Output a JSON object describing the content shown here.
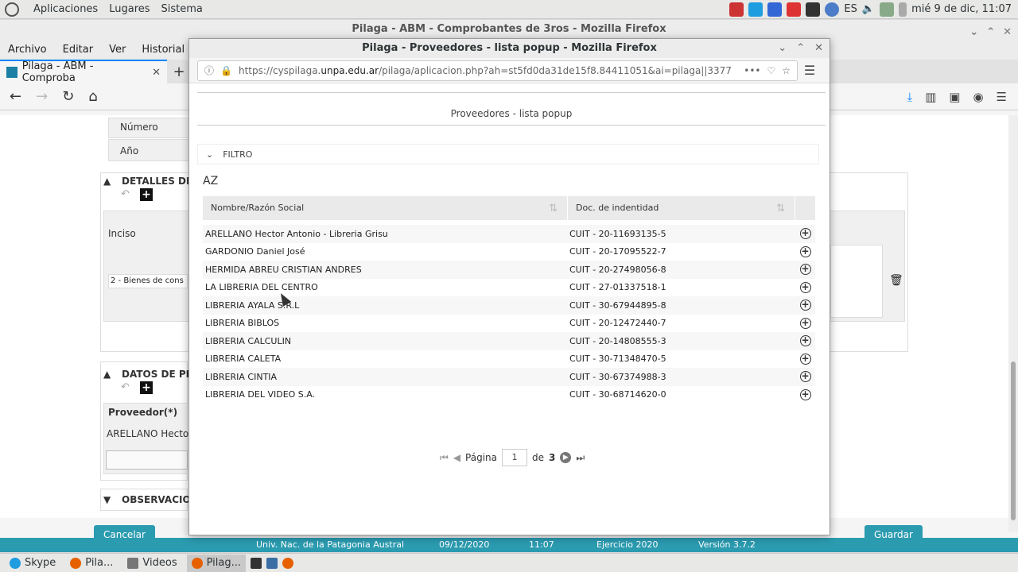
{
  "top_panel": {
    "menu": [
      "Aplicaciones",
      "Lugares",
      "Sistema"
    ],
    "lang": "ES",
    "clock": "mié  9 de dic, 11:07"
  },
  "main_window": {
    "title": "Pilaga - ABM - Comprobantes de 3ros - Mozilla Firefox",
    "menubar": [
      "Archivo",
      "Editar",
      "Ver",
      "Historial"
    ],
    "tab_label": "Pilaga - ABM - Comproba",
    "form": {
      "numero_label": "Número",
      "anio_label": "Año",
      "detalles_title": "DETALLES DEL",
      "inciso_label": "Inciso",
      "inciso_value": "2 - Bienes de cons",
      "datos_title": "DATOS DE PRE",
      "proveedor_label": "Proveedor(*)",
      "proveedor_value": "ARELLANO Hector",
      "observaciones_title": "OBSERVACIO",
      "cancel_label": "Cancelar",
      "save_label": "Guardar"
    },
    "status": {
      "org": "Univ. Nac. de la Patagonia Austral",
      "date": "09/12/2020",
      "time": "11:07",
      "ejercicio": "Ejercicio 2020",
      "version": "Versión 3.7.2"
    }
  },
  "popup": {
    "title": "Pilaga - Proveedores - lista popup - Mozilla Firefox",
    "url_prefix": "https://cyspilaga.",
    "url_domain": "unpa.edu.ar",
    "url_rest": "/pilaga/aplicacion.php?ah=st5fd0da31de15f8.84411051&ai=pilaga||3377",
    "header": "Proveedores - lista popup",
    "filtro_label": "FILTRO",
    "az_label": "AZ",
    "columns": [
      "Nombre/Razón Social",
      "Doc. de indentidad"
    ],
    "rows": [
      {
        "name": "ARELLANO Hector Antonio - Libreria Grisu",
        "doc": "CUIT - 20-11693135-5"
      },
      {
        "name": "GARDONIO Daniel José",
        "doc": "CUIT - 20-17095522-7"
      },
      {
        "name": "HERMIDA ABREU CRISTIAN ANDRES",
        "doc": "CUIT - 20-27498056-8"
      },
      {
        "name": "LA LIBRERIA DEL CENTRO",
        "doc": "CUIT - 27-01337518-1"
      },
      {
        "name": "LIBRERIA AYALA S.R.L",
        "doc": "CUIT - 30-67944895-8"
      },
      {
        "name": "LIBRERIA BIBLOS",
        "doc": "CUIT - 20-12472440-7"
      },
      {
        "name": "LIBRERIA CALCULIN",
        "doc": "CUIT - 20-14808555-3"
      },
      {
        "name": "LIBRERIA CALETA",
        "doc": "CUIT - 30-71348470-5"
      },
      {
        "name": "LIBRERIA CINTIA",
        "doc": "CUIT - 30-67374988-3"
      },
      {
        "name": "LIBRERIA DEL VIDEO S.A.",
        "doc": "CUIT - 30-68714620-0"
      }
    ],
    "pager": {
      "pagina_label": "Página",
      "current_page": "1",
      "of_label": "de",
      "total_pages": "3"
    }
  },
  "taskbar": {
    "items": [
      "Skype",
      "Pila...",
      "Videos",
      "Pilag..."
    ]
  },
  "colors": {
    "accent_teal": "#2b9bb0",
    "firefox_blue": "#0a84ff"
  }
}
